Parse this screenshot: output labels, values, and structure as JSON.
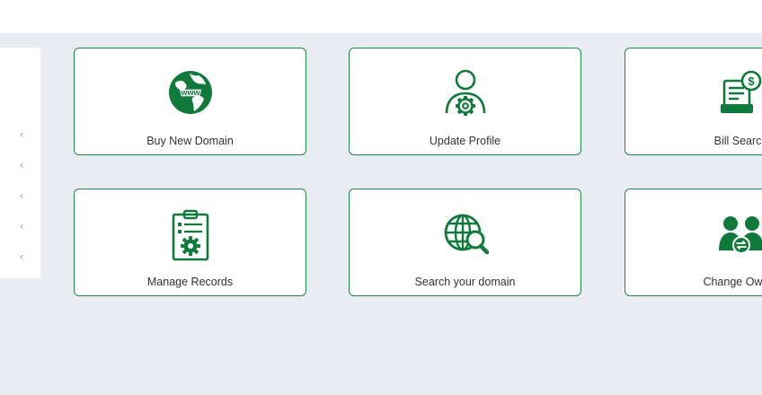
{
  "theme": {
    "accent": "#0f7a3a",
    "border": "#1f8a45",
    "background": "#e9ecf3"
  },
  "sidebar": {
    "toggles": [
      "‹",
      "‹",
      "‹",
      "‹",
      "‹"
    ]
  },
  "cards": [
    {
      "label": "Buy New Domain",
      "icon": "globe-www-icon"
    },
    {
      "label": "Update Profile",
      "icon": "user-settings-icon"
    },
    {
      "label": "Bill Search",
      "icon": "bill-search-icon"
    },
    {
      "label": "Manage Records",
      "icon": "clipboard-settings-icon"
    },
    {
      "label": "Search your domain",
      "icon": "globe-search-icon"
    },
    {
      "label": "Change Owner",
      "icon": "change-owner-icon"
    }
  ]
}
